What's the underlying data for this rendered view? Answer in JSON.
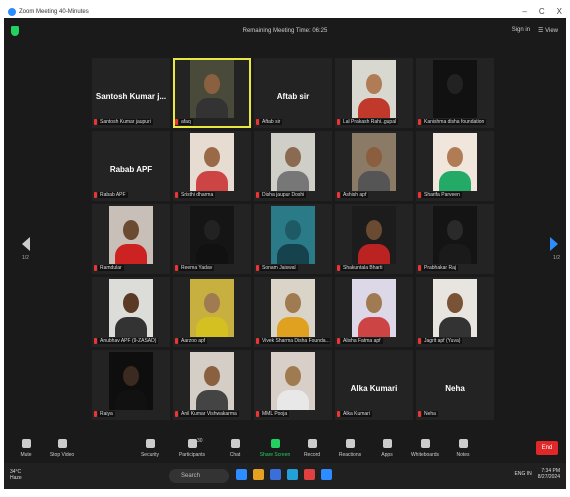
{
  "window": {
    "title": "Zoom Meeting 40-Minutes",
    "controls": [
      "–",
      "C",
      "X"
    ]
  },
  "meeting": {
    "remaining": "Remaining Meeting Time: 06:25",
    "sign_in": "Sign in",
    "view": "☰ View"
  },
  "pager": {
    "left": "1/2",
    "right": "1/2"
  },
  "participants": [
    {
      "name": "Santosh Kumar Jaypuria",
      "label": "Santosh Kumar jaupuri",
      "show_name": "Santosh Kumar j...",
      "video": false
    },
    {
      "name": "afaq",
      "label": "afaq",
      "video": true,
      "active": true,
      "bg": "#4a4a3a",
      "skin": "#8a6040",
      "shirt": "#333"
    },
    {
      "name": "Aftab sir",
      "label": "Aftab sir",
      "show_name": "Aftab sir",
      "video": false
    },
    {
      "name": "Lal Prakash",
      "label": "Lal Prakash Rahi..gupal",
      "video": true,
      "bg": "#d8d8d0",
      "skin": "#b07c55",
      "shirt": "#c0392b"
    },
    {
      "name": "Kanishma disha",
      "label": "Kanishma disha foundation",
      "video": true,
      "bg": "#111",
      "skin": "#222",
      "shirt": "#111"
    },
    {
      "name": "Rabab APF",
      "label": "Rabab APF",
      "show_name": "Rabab APF",
      "video": false
    },
    {
      "name": "Sristhi",
      "label": "Sristhi dharma",
      "video": true,
      "bg": "#e6dcd2",
      "skin": "#9a6a48",
      "shirt": "#c44"
    },
    {
      "name": "Disha Jaupur",
      "label": "Disha jaupur Doshi",
      "video": true,
      "bg": "#cfcfc8",
      "skin": "#8a6a50",
      "shirt": "#777"
    },
    {
      "name": "Ashish",
      "label": "Ashish apf",
      "video": true,
      "bg": "#8a7a66",
      "skin": "#8a5e3e",
      "shirt": "#555"
    },
    {
      "name": "Sharifa Parveen",
      "label": "Sharifa Parveen",
      "video": true,
      "bg": "#f0e6dc",
      "skin": "#b07c55",
      "shirt": "#2a6"
    },
    {
      "name": "Ramdular",
      "label": "Ramdular",
      "video": true,
      "bg": "#c8c0b8",
      "skin": "#6a4a30",
      "shirt": "#c22"
    },
    {
      "name": "Reema Yadav",
      "label": "Reema Yadav",
      "video": true,
      "bg": "#151515",
      "skin": "#222",
      "shirt": "#111"
    },
    {
      "name": "Sonam Jaiswal",
      "label": "Sonam Jaiswal",
      "video": true,
      "bg": "#2a7a88",
      "skin": "#1e5a66",
      "shirt": "#15424c"
    },
    {
      "name": "Shakuntala Bharti",
      "label": "Shakuntala Bharti",
      "video": true,
      "bg": "#1c1c1c",
      "skin": "#6a4a30",
      "shirt": "#b22"
    },
    {
      "name": "Prabhakar Raj",
      "label": "Prabhakar Raj",
      "video": true,
      "bg": "#141414",
      "skin": "#2a2a2a",
      "shirt": "#1a1a1a"
    },
    {
      "name": "Anubhav APF",
      "label": "Anubhav APF (9-ZASAD)",
      "video": true,
      "bg": "#dcdcd8",
      "skin": "#5a3a24",
      "shirt": "#333"
    },
    {
      "name": "Aarzoo",
      "label": "Aarzoo apf",
      "video": true,
      "bg": "#c8b040",
      "skin": "#a07a50",
      "shirt": "#d4c020"
    },
    {
      "name": "Vivek Sharma",
      "label": "Vivek Sharma Disha Founda...",
      "video": true,
      "bg": "#dad4c8",
      "skin": "#a07a50",
      "shirt": "#e0a020"
    },
    {
      "name": "Alisha Fatma",
      "label": "Alisha Fatma apf",
      "video": true,
      "bg": "#dcd8e8",
      "skin": "#a07a50",
      "shirt": "#c44"
    },
    {
      "name": "Jagrit",
      "label": "Jagrit apf (Yuva)",
      "video": true,
      "bg": "#e8e4e0",
      "skin": "#7a5236",
      "shirt": "#333"
    },
    {
      "name": "Raiya",
      "label": "Raiya",
      "video": true,
      "bg": "#0e0e0e",
      "skin": "#3a2a20",
      "shirt": "#111"
    },
    {
      "name": "Anil Kumar",
      "label": "Anil Kumar Vishwakarma",
      "video": true,
      "bg": "#d4cec6",
      "skin": "#8a6040",
      "shirt": "#444"
    },
    {
      "name": "MML Pooja",
      "label": "MML Pooja",
      "video": true,
      "bg": "#d8cfc8",
      "skin": "#a07a50",
      "shirt": "#e8e8e8"
    },
    {
      "name": "Alka Kumari",
      "label": "Alka Kumari",
      "show_name": "Alka Kumari",
      "video": false
    },
    {
      "name": "Neha",
      "label": "Neha",
      "show_name": "Neha",
      "video": false
    }
  ],
  "toolbar": [
    {
      "label": "Mute",
      "icon": "microphone-icon"
    },
    {
      "label": "Stop Video",
      "icon": "camera-icon"
    },
    {
      "label": "Security",
      "icon": "shield-icon"
    },
    {
      "label": "Participants",
      "icon": "people-icon",
      "count": "30"
    },
    {
      "label": "Chat",
      "icon": "chat-icon"
    },
    {
      "label": "Share Screen",
      "icon": "share-screen-icon"
    },
    {
      "label": "Record",
      "icon": "record-icon"
    },
    {
      "label": "Reactions",
      "icon": "reactions-icon"
    },
    {
      "label": "Apps",
      "icon": "apps-icon"
    },
    {
      "label": "Whiteboards",
      "icon": "whiteboard-icon"
    },
    {
      "label": "Notes",
      "icon": "notes-icon"
    }
  ],
  "end_label": "End",
  "taskbar": {
    "weather_temp": "34°C",
    "weather_cond": "Haze",
    "search": "Search",
    "lang": "ENG",
    "region": "IN",
    "time": "7:34 PM",
    "date": "8/27/2024"
  },
  "colors": {
    "share": "#23d160",
    "end": "#e02828",
    "active": "#e8e840",
    "nav": "#2d8cff"
  }
}
